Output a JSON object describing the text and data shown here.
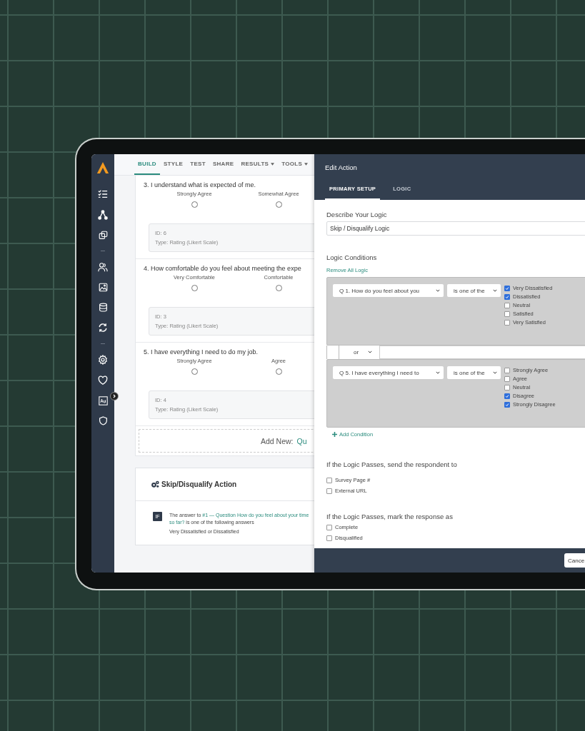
{
  "nav_tabs": [
    {
      "label": "BUILD",
      "selected": true,
      "dropdown": false
    },
    {
      "label": "STYLE",
      "selected": false,
      "dropdown": false
    },
    {
      "label": "TEST",
      "selected": false,
      "dropdown": false
    },
    {
      "label": "SHARE",
      "selected": false,
      "dropdown": false
    },
    {
      "label": "RESULTS",
      "selected": false,
      "dropdown": true
    },
    {
      "label": "TOOLS",
      "selected": false,
      "dropdown": true
    }
  ],
  "questions": [
    {
      "title": "3. I understand what is expected of me.",
      "options": [
        {
          "label": "Strongly Agree",
          "selected": false
        },
        {
          "label": "Somewhat Agree",
          "selected": false
        }
      ],
      "id": "ID: 6",
      "type": "Type: Rating (Likert Scale)"
    },
    {
      "title": "4. How comfortable do you feel about meeting the expe",
      "options": [
        {
          "label": "Very Comfortable",
          "selected": false
        },
        {
          "label": "Comfortable",
          "selected": false
        }
      ],
      "id": "ID: 3",
      "type": "Type: Rating (Likert Scale)"
    },
    {
      "title": "5. I have everything I need to do my job.",
      "options": [
        {
          "label": "Strongly Agree",
          "selected": false
        },
        {
          "label": "Agree",
          "selected": false
        }
      ],
      "id": "ID: 4",
      "type": "Type: Rating (Likert Scale)"
    }
  ],
  "add_new": {
    "label": "Add New:",
    "link": "Qu"
  },
  "action_card": {
    "title": "Skip/Disqualify Action",
    "badge": "IF",
    "prefix": "The answer to ",
    "link": "#1 — Question How do you feel about your time",
    "link_end": "so far?",
    "suffix": " is one of the following answers",
    "answers": "Very Dissatisfied or Dissatisfied"
  },
  "panel": {
    "title": "Edit Action",
    "tabs": [
      {
        "label": "PRIMARY SETUP",
        "selected": true
      },
      {
        "label": "LOGIC",
        "selected": false
      }
    ],
    "describe_label": "Describe Your Logic",
    "describe_value": "Skip / Disqualify Logic",
    "conditions_label": "Logic Conditions",
    "remove_all": "Remove All Logic",
    "conditions": [
      {
        "question": "Q 1. How do you feel about you",
        "operator": "is one of the",
        "answers": [
          {
            "label": "Very Dissatisfied",
            "checked": true
          },
          {
            "label": "Dissatisfied",
            "checked": true
          },
          {
            "label": "Neutral",
            "checked": false
          },
          {
            "label": "Satisfied",
            "checked": false
          },
          {
            "label": "Very Satisfied",
            "checked": false
          }
        ]
      },
      {
        "question": "Q 5. I have everything I need to",
        "operator": "is one of the",
        "answers": [
          {
            "label": "Strongly Agree",
            "checked": false
          },
          {
            "label": "Agree",
            "checked": false
          },
          {
            "label": "Neutral",
            "checked": false
          },
          {
            "label": "Disagree",
            "checked": true
          },
          {
            "label": "Strongly Disagree",
            "checked": true
          }
        ]
      }
    ],
    "joiner": "or",
    "add_condition": "Add Condition",
    "send_label": "If the Logic Passes, send the respondent to",
    "send_options": [
      {
        "label": "Survey Page #",
        "checked": false
      },
      {
        "label": "External URL",
        "checked": false
      }
    ],
    "mark_label": "If the Logic Passes, mark the response as",
    "mark_options": [
      {
        "label": "Complete",
        "checked": false
      },
      {
        "label": "Disqualified",
        "checked": false
      }
    ],
    "cancel": "Cance"
  }
}
